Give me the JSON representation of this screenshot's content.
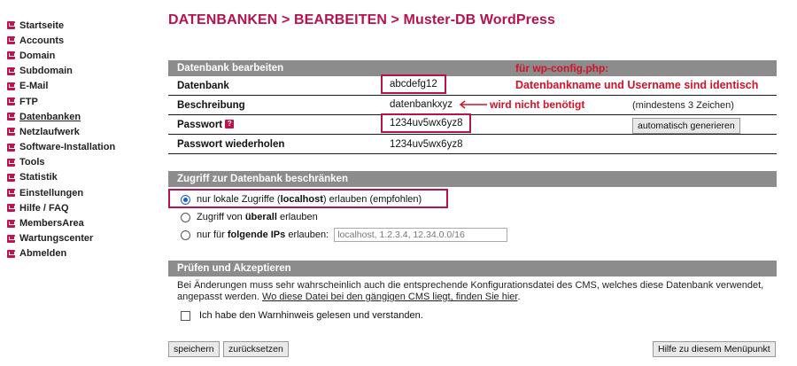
{
  "sidebar": {
    "items": [
      {
        "label": "Startseite"
      },
      {
        "label": "Accounts"
      },
      {
        "label": "Domain"
      },
      {
        "label": "Subdomain"
      },
      {
        "label": "E-Mail"
      },
      {
        "label": "FTP"
      },
      {
        "label": "Datenbanken"
      },
      {
        "label": "Netzlaufwerk"
      },
      {
        "label": "Software-Installation"
      },
      {
        "label": "Tools"
      },
      {
        "label": "Statistik"
      },
      {
        "label": "Einstellungen"
      },
      {
        "label": "Hilfe / FAQ"
      },
      {
        "label": "MembersArea"
      },
      {
        "label": "Wartungscenter"
      },
      {
        "label": "Abmelden"
      }
    ]
  },
  "title": {
    "prefix": "DATENBANKEN > BEARBEITEN > ",
    "name": "Muster-DB WordPress"
  },
  "edit": {
    "header": "Datenbank bearbeiten",
    "db_label": "Datenbank",
    "db_value": "abcdefg12",
    "desc_label": "Beschreibung",
    "desc_value": "datenbankxyz",
    "desc_hint": "(mindestens 3 Zeichen)",
    "pw_label": "Passwort",
    "pw_value": "1234uv5wx6yz8",
    "pw_button": "automatisch generieren",
    "pw2_label": "Passwort wiederholen",
    "pw2_value": "1234uv5wx6yz8",
    "help_glyph": "?"
  },
  "annotations": {
    "wpconfig": "für wp-config.php:",
    "identical": "Datenbankname und Username sind identisch",
    "not_needed": "wird nicht benötigt"
  },
  "access": {
    "header": "Zugriff zur Datenbank beschränken",
    "opt_local_pre": "nur lokale Zugriffe (",
    "opt_local_bold": "localhost",
    "opt_local_post": ") erlauben (empfohlen)",
    "opt_all_pre": "Zugriff von ",
    "opt_all_bold": "überall",
    "opt_all_post": " erlauben",
    "opt_ips_pre": "nur für ",
    "opt_ips_bold": "folgende IPs",
    "opt_ips_post": " erlauben:",
    "ips_placeholder": "localhost, 1.2.3.4, 12.34.0.0/16"
  },
  "confirm": {
    "header": "Prüfen und Akzeptieren",
    "text": "Bei Änderungen muss sehr wahrscheinlich auch die entsprechende Konfigurationsdatei des CMS, welches diese Datenbank verwendet, angepasst werden.",
    "link": "Wo diese Datei bei den gängigen CMS liegt, finden Sie hier",
    "link_end": ".",
    "checkbox_label": "Ich habe den Warnhinweis gelesen und verstanden."
  },
  "buttons": {
    "save": "speichern",
    "reset": "zurücksetzen",
    "help": "Hilfe zu diesem Menüpunkt"
  },
  "colors": {
    "accent": "#b5134f",
    "annotation_red": "#d1132a",
    "section_header": "#8c8c8c"
  }
}
